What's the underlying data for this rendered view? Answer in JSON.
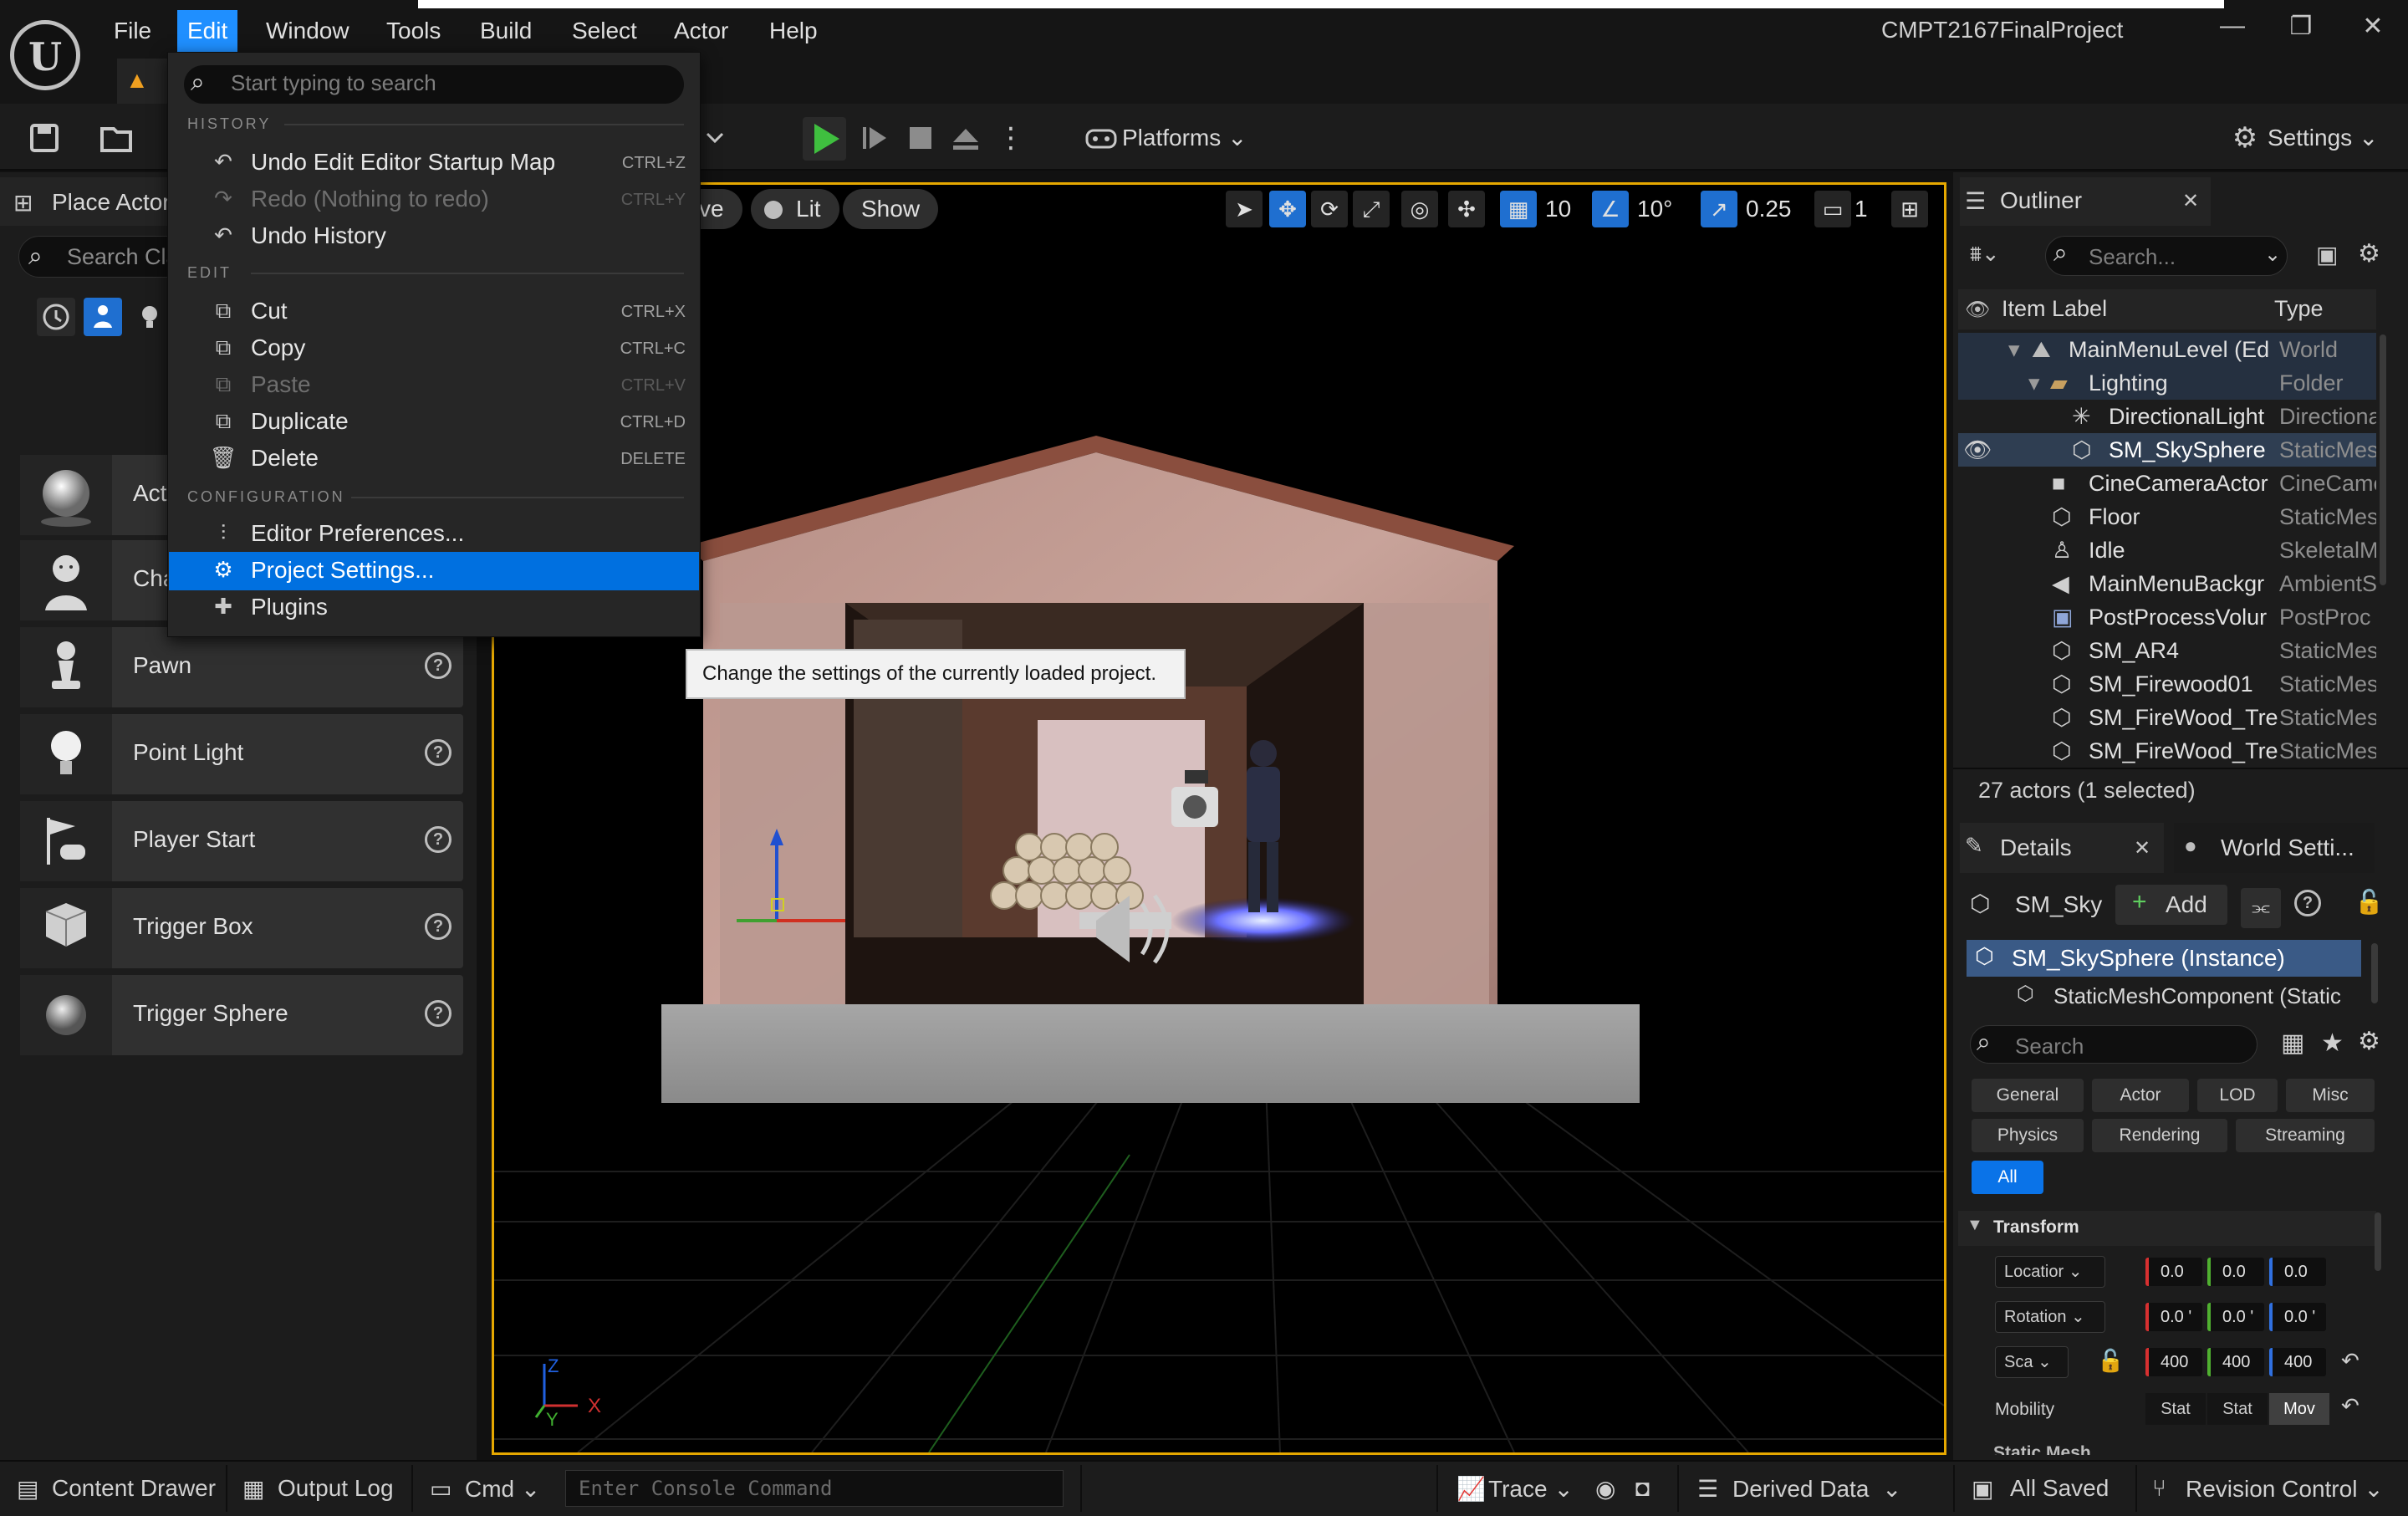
{
  "app": {
    "project_title": "CMPT2167FinalProject",
    "logo_text": "U",
    "menus": [
      "File",
      "Edit",
      "Window",
      "Tools",
      "Build",
      "Select",
      "Actor",
      "Help"
    ],
    "active_menu": "Edit",
    "accent_color": "#1f8fff",
    "viewport_border_color": "#e6a800"
  },
  "toolbar": {
    "platforms_label": "Platforms",
    "settings_label": "Settings"
  },
  "edit_menu": {
    "search_placeholder": "Start typing to search",
    "history_header": "HISTORY",
    "edit_header": "EDIT",
    "config_header": "CONFIGURATION",
    "items": [
      {
        "label": "Undo Edit Editor Startup Map",
        "shortcut": "CTRL+Z",
        "enabled": true,
        "icon": "undo-icon"
      },
      {
        "label": "Redo (Nothing to redo)",
        "shortcut": "CTRL+Y",
        "enabled": false,
        "icon": "redo-icon"
      },
      {
        "label": "Undo History",
        "shortcut": "",
        "enabled": true,
        "icon": "undo-history-icon"
      },
      {
        "label": "Cut",
        "shortcut": "CTRL+X",
        "enabled": true,
        "icon": "cut-icon"
      },
      {
        "label": "Copy",
        "shortcut": "CTRL+C",
        "enabled": true,
        "icon": "copy-icon"
      },
      {
        "label": "Paste",
        "shortcut": "CTRL+V",
        "enabled": false,
        "icon": "paste-icon"
      },
      {
        "label": "Duplicate",
        "shortcut": "CTRL+D",
        "enabled": true,
        "icon": "duplicate-icon"
      },
      {
        "label": "Delete",
        "shortcut": "DELETE",
        "enabled": true,
        "icon": "trash-icon"
      },
      {
        "label": "Editor Preferences...",
        "shortcut": "",
        "enabled": true,
        "icon": "sliders-icon"
      },
      {
        "label": "Project Settings...",
        "shortcut": "",
        "enabled": true,
        "icon": "project-settings-icon"
      },
      {
        "label": "Plugins",
        "shortcut": "",
        "enabled": true,
        "icon": "plugin-icon"
      }
    ],
    "selected_item": "Project Settings..."
  },
  "tooltip": "Change the settings of the currently loaded project.",
  "place_actors": {
    "title": "Place Actor",
    "search_placeholder": "Search Cla",
    "items": [
      {
        "label": "Acto",
        "icon": "sphere-actor-icon"
      },
      {
        "label": "Cha",
        "icon": "character-icon"
      },
      {
        "label": "Pawn",
        "icon": "pawn-icon"
      },
      {
        "label": "Point Light",
        "icon": "light-bulb-icon"
      },
      {
        "label": "Player Start",
        "icon": "player-start-icon"
      },
      {
        "label": "Trigger Box",
        "icon": "trigger-box-icon"
      },
      {
        "label": "Trigger Sphere",
        "icon": "trigger-sphere-icon"
      }
    ]
  },
  "viewport": {
    "mode_tail": "ve",
    "lit_label": "Lit",
    "show_label": "Show",
    "grid_snap": "10",
    "rotation_snap": "10°",
    "scale_snap": "0.25",
    "camera_speed": "1"
  },
  "outliner": {
    "title": "Outliner",
    "search_placeholder": "Search...",
    "col_label": "Item Label",
    "col_type": "Type",
    "rows": [
      {
        "name": "MainMenuLevel (Ed",
        "type": "World",
        "icon": "world-icon"
      },
      {
        "name": "Lighting",
        "type": "Folder",
        "icon": "folder-icon"
      },
      {
        "name": "DirectionalLight",
        "type": "Directiona",
        "icon": "directional-light-icon"
      },
      {
        "name": "SM_SkySphere",
        "type": "StaticMes",
        "icon": "static-mesh-icon"
      },
      {
        "name": "CineCameraActor",
        "type": "CineCame",
        "icon": "camera-icon"
      },
      {
        "name": "Floor",
        "type": "StaticMes",
        "icon": "static-mesh-icon"
      },
      {
        "name": "Idle",
        "type": "SkeletalM",
        "icon": "skeletal-mesh-icon"
      },
      {
        "name": "MainMenuBackgr",
        "type": "AmbientS",
        "icon": "speaker-icon"
      },
      {
        "name": "PostProcessVolur",
        "type": "PostProc",
        "icon": "volume-icon"
      },
      {
        "name": "SM_AR4",
        "type": "StaticMes",
        "icon": "static-mesh-icon"
      },
      {
        "name": "SM_Firewood01",
        "type": "StaticMes",
        "icon": "static-mesh-icon"
      },
      {
        "name": "SM_FireWood_Tre",
        "type": "StaticMes",
        "icon": "static-mesh-icon"
      },
      {
        "name": "SM_FireWood_Tre",
        "type": "StaticMes",
        "icon": "static-mesh-icon"
      }
    ],
    "actor_count": "27 actors (1 selected)"
  },
  "details": {
    "title": "Details",
    "world_settings_tab": "World Setti...",
    "object_name": "SM_Sky",
    "add_label": "Add",
    "instance_label": "SM_SkySphere (Instance)",
    "component_label": "StaticMeshComponent (Static",
    "search_placeholder": "Search",
    "categories": [
      "General",
      "Actor",
      "LOD",
      "Misc",
      "Physics",
      "Rendering",
      "Streaming",
      "All"
    ],
    "active_category": "All",
    "transform_header": "Transform",
    "location_label": "Locatior",
    "rotation_label": "Rotation",
    "scale_label": "Sca",
    "location": [
      "0.0",
      "0.0",
      "0.0"
    ],
    "rotation": [
      "0.0 '",
      "0.0 '",
      "0.0 '"
    ],
    "scale": [
      "400",
      "400",
      "400"
    ],
    "mobility_label": "Mobility",
    "mobility_options": [
      "Stat",
      "Stat",
      "Mov"
    ],
    "mobility_selected": "Mov",
    "cut_header": "Static Mesh"
  },
  "statusbar": {
    "content_drawer": "Content Drawer",
    "output_log": "Output Log",
    "cmd": "Cmd",
    "console_placeholder": "Enter Console Command",
    "trace": "Trace",
    "derived_data": "Derived Data",
    "all_saved": "All Saved",
    "revision_control": "Revision Control"
  }
}
